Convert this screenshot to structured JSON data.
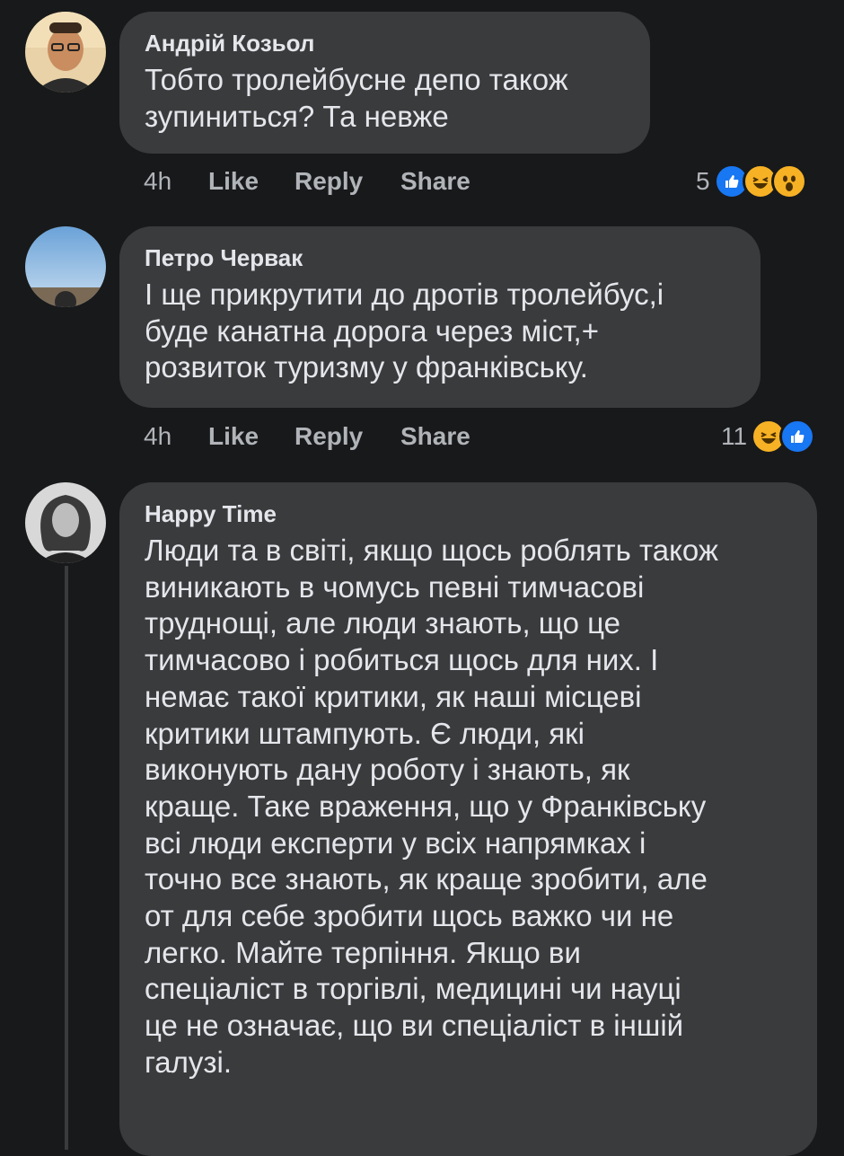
{
  "comments": [
    {
      "author": "Андрій Козьол",
      "text": "Тобто тролейбусне депо також\nзупиниться? Та невже",
      "time": "4h",
      "like": "Like",
      "reply": "Reply",
      "share": "Share",
      "reaction_count": "5",
      "reactions": [
        "like",
        "haha",
        "wow"
      ]
    },
    {
      "author": "Петро Червак",
      "text": "І ще прикрутити до дротів тролейбус,і\nбуде канатна дорога через міст,+\nрозвиток туризму у франківську.",
      "time": "4h",
      "like": "Like",
      "reply": "Reply",
      "share": "Share",
      "reaction_count": "11",
      "reactions": [
        "haha",
        "like"
      ]
    },
    {
      "author": "Happy Time",
      "text": "Люди та в світі, якщо щось роблять також\nвиникають в чомусь певні тимчасові\nтруднощі, але люди знають, що це\nтимчасово і робиться щось для них. І\nнемає такої критики, як наші місцеві\nкритики штампують. Є люди, які\nвиконують дану роботу і знають, як\nкраще. Таке враження,  що у Франківську\nвсі люди експерти у всіх напрямках і\nточно все знають, як краще зробити, але\nот для себе зробити щось важко чи не\nлегко. Майте терпіння.  Якщо ви\nспеціаліст в торгівлі, медицині чи науці\nце не означає, що ви спеціаліст в іншій\nгалузі."
    }
  ],
  "colors": {
    "background": "#18191a",
    "bubble": "#3a3b3c",
    "text": "#e4e6eb",
    "muted": "#b0b3b8",
    "like_blue": "#1877f2",
    "haha_yellow": "#f7b125"
  }
}
